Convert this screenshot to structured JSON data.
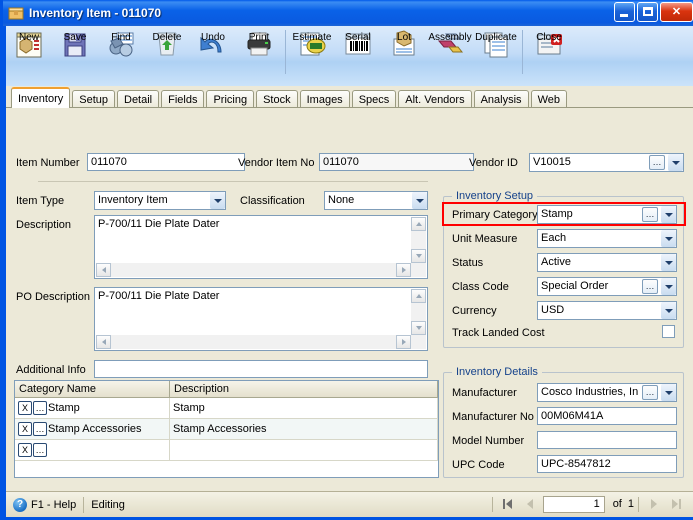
{
  "window": {
    "title_prefix": "Inventory Item",
    "title_sep": "-",
    "title_id": "011070",
    "title_full": "Inventory Item - 011070",
    "icon": "inventory-box-icon",
    "controls": {
      "minimize": "Minimize",
      "maximize": "Maximize",
      "close": "Close",
      "close_glyph": "✕"
    }
  },
  "toolbar": {
    "items": [
      {
        "label": "New",
        "icon": "new-document-icon"
      },
      {
        "label": "Save",
        "icon": "floppy-disk-icon"
      },
      {
        "label": "Find",
        "icon": "binoculars-icon"
      },
      {
        "label": "Delete",
        "icon": "recycle-bin-icon"
      },
      {
        "label": "Undo",
        "icon": "undo-arrow-icon"
      },
      {
        "label": "Print",
        "icon": "printer-icon"
      },
      {
        "label": "Estimate",
        "icon": "estimate-tag-icon"
      },
      {
        "label": "Serial",
        "icon": "barcode-icon"
      },
      {
        "label": "Lot",
        "icon": "lot-box-icon"
      },
      {
        "label": "Assembly",
        "icon": "assembly-blocks-icon"
      },
      {
        "label": "Duplicate",
        "icon": "duplicate-pages-icon"
      },
      {
        "label": "Close",
        "icon": "close-window-icon"
      }
    ],
    "separator_after": [
      5,
      10
    ]
  },
  "tabs": [
    {
      "label": "Inventory",
      "active": true
    },
    {
      "label": "Setup",
      "active": false
    },
    {
      "label": "Detail",
      "active": false
    },
    {
      "label": "Fields",
      "active": false
    },
    {
      "label": "Pricing",
      "active": false
    },
    {
      "label": "Stock",
      "active": false
    },
    {
      "label": "Images",
      "active": false
    },
    {
      "label": "Specs",
      "active": false
    },
    {
      "label": "Alt. Vendors",
      "active": false
    },
    {
      "label": "Analysis",
      "active": false
    },
    {
      "label": "Web",
      "active": false
    }
  ],
  "form": {
    "item_number": {
      "label": "Item Number",
      "value": "011070"
    },
    "vendor_item_no": {
      "label": "Vendor Item No",
      "value": "011070"
    },
    "vendor_id": {
      "label": "Vendor ID",
      "value": "V10015",
      "ellipsis": "…",
      "has_dropdown": true
    },
    "item_type": {
      "label": "Item Type",
      "value": "Inventory Item"
    },
    "classification": {
      "label": "Classification",
      "value": "None"
    },
    "description": {
      "label": "Description",
      "value": "P-700/11 Die Plate Dater"
    },
    "po_description": {
      "label": "PO Description",
      "value": "P-700/11 Die Plate Dater"
    },
    "additional_info": {
      "label": "Additional Info",
      "value": ""
    }
  },
  "inventory_setup": {
    "title": "Inventory Setup",
    "primary_category": {
      "label": "Primary Category",
      "value": "Stamp",
      "ellipsis": "…",
      "highlighted": true
    },
    "unit_measure": {
      "label": "Unit Measure",
      "value": "Each"
    },
    "status": {
      "label": "Status",
      "value": "Active"
    },
    "class_code": {
      "label": "Class Code",
      "value": "Special Order",
      "ellipsis": "…"
    },
    "currency": {
      "label": "Currency",
      "value": "USD"
    },
    "track_landed_cost": {
      "label": "Track Landed Cost",
      "checked": false
    }
  },
  "inventory_details": {
    "title": "Inventory Details",
    "manufacturer": {
      "label": "Manufacturer",
      "value": "Cosco Industries, In",
      "ellipsis": "…"
    },
    "manufacturer_no": {
      "label": "Manufacturer No",
      "value": "00M06M41A"
    },
    "model_number": {
      "label": "Model Number",
      "value": ""
    },
    "upc_code": {
      "label": "UPC Code",
      "value": "UPC-8547812"
    }
  },
  "category_grid": {
    "columns": [
      "Category Name",
      "Description"
    ],
    "rows": [
      {
        "delete": "X",
        "browse": "…",
        "name": "Stamp",
        "description": "Stamp"
      },
      {
        "delete": "X",
        "browse": "…",
        "name": "Stamp Accessories",
        "description": "Stamp Accessories"
      },
      {
        "delete": "X",
        "browse": "…",
        "name": "",
        "description": ""
      }
    ]
  },
  "statusbar": {
    "help_icon": "help-question-icon",
    "help_text": "F1 - Help",
    "mode": "Editing",
    "nav": {
      "first": "first-record-button",
      "prev": "previous-record-button",
      "page": "1",
      "of_label": "of",
      "total": "1",
      "next": "next-record-button",
      "last": "last-record-button"
    }
  },
  "colors": {
    "title_blue": "#0a5ae0",
    "group_label": "#15428b",
    "highlight_red": "#ff0000",
    "form_bg": "#ece9d8",
    "active_tab_top": "#f0a030"
  }
}
